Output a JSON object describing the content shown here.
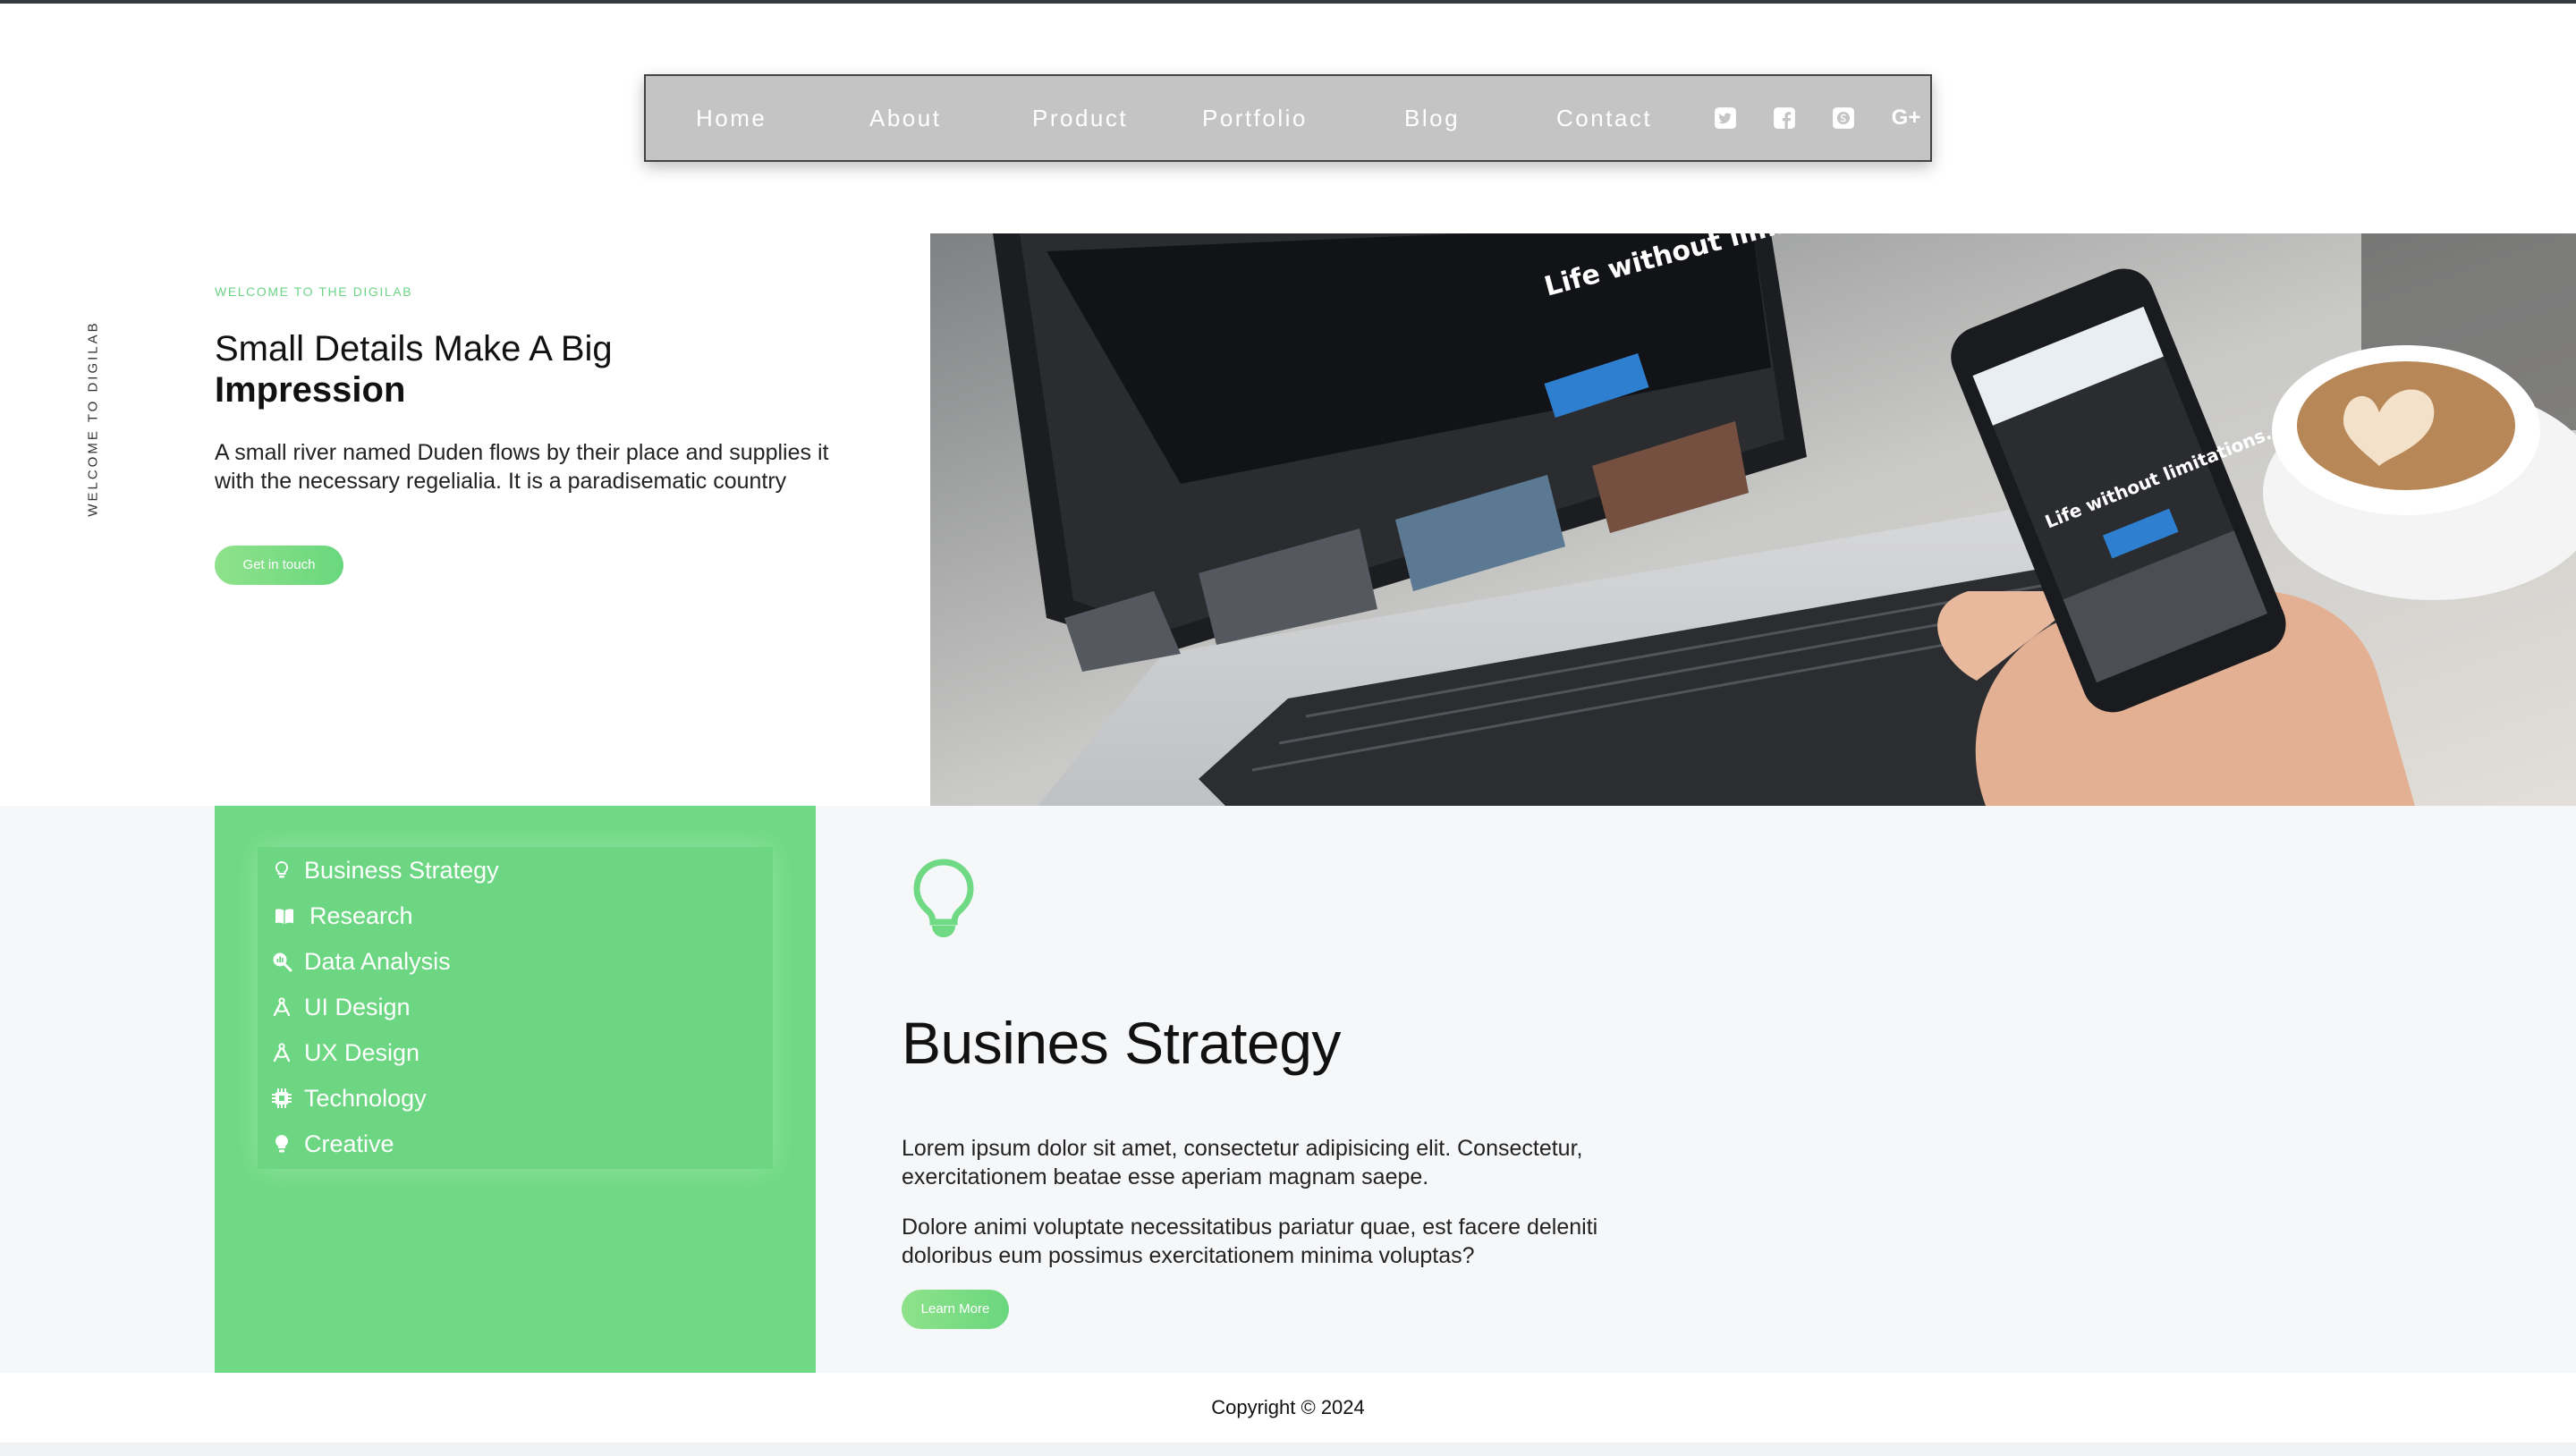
{
  "nav": {
    "links": [
      "Home",
      "About",
      "Product",
      "Portfolio",
      "Blog",
      "Contact"
    ],
    "social_icons": [
      "twitter-icon",
      "facebook-icon",
      "skype-icon",
      "google-plus-icon"
    ],
    "google_plus_glyph": "G+"
  },
  "hero": {
    "side_text": "WELCOME TO DIGILAB",
    "eyebrow": "WELCOME TO THE DIGILAB",
    "title_light": "Small Details Make A Big",
    "title_bold": "Impression",
    "text": "A small river named Duden flows by their place and supplies it with the necessary regelialia. It is a paradisematic country",
    "button": "Get in touch",
    "screen_laptop_text": "Life without limitations.",
    "screen_phone_text": "Life without limitations."
  },
  "services": {
    "items": [
      {
        "label": "Business Strategy",
        "icon": "lightbulb-outline-icon"
      },
      {
        "label": "Research",
        "icon": "book-open-icon"
      },
      {
        "label": "Data Analysis",
        "icon": "search-chart-icon"
      },
      {
        "label": "UI Design",
        "icon": "drafting-compass-icon"
      },
      {
        "label": "UX Design",
        "icon": "drafting-compass-icon"
      },
      {
        "label": "Technology",
        "icon": "chip-icon"
      },
      {
        "label": "Creative",
        "icon": "lightbulb-icon"
      }
    ],
    "active": {
      "title": "Busines Strategy",
      "p1": "Lorem ipsum dolor sit amet, consectetur adipisicing elit. Consectetur, exercitationem beatae esse aperiam magnam saepe.",
      "p2": "Dolore animi voluptate necessitatibus pariatur quae, est facere deleniti doloribus eum possimus exercitationem minima voluptas?",
      "button": "Learn More"
    }
  },
  "footer": {
    "copyright": "Copyright © 2024"
  },
  "colors": {
    "accent_green": "#6fd983",
    "nav_gray": "#c4c4c4",
    "band_bg": "#f6f7f9"
  }
}
